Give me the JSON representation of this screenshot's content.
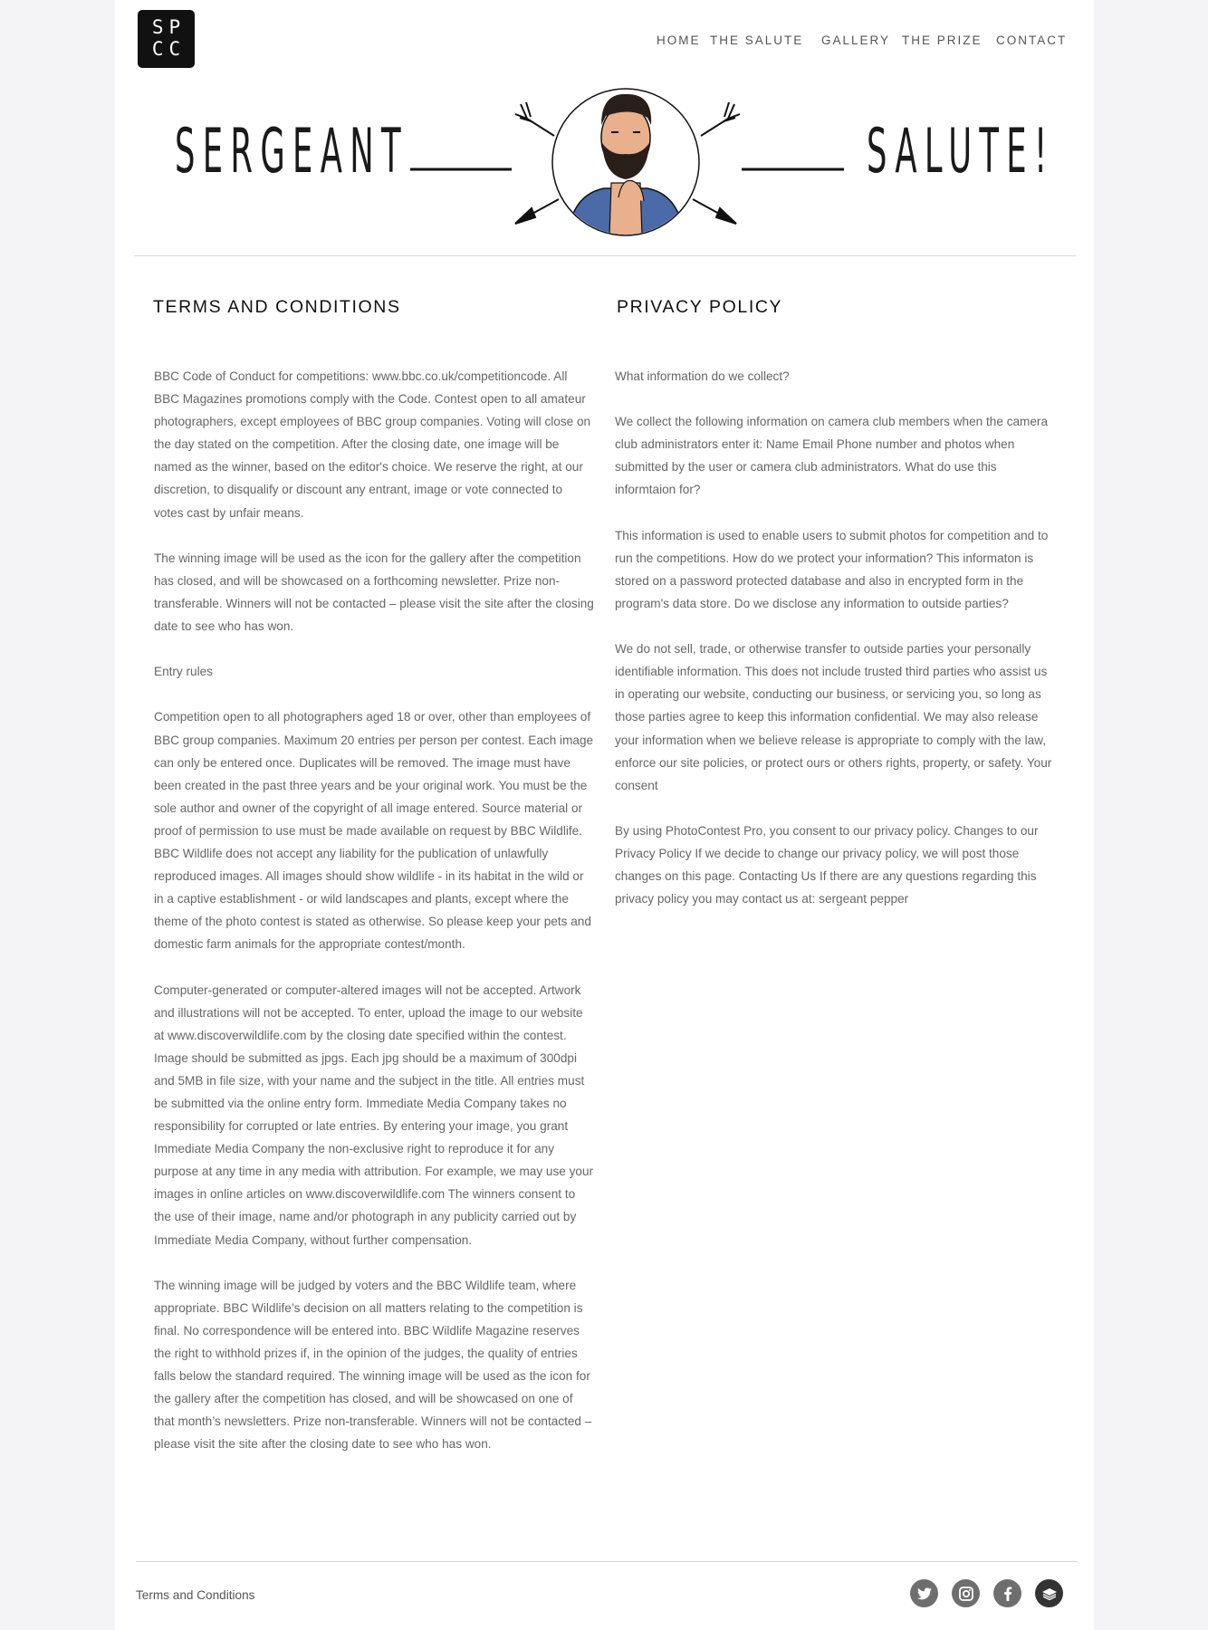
{
  "logo": {
    "line1": "SP",
    "line2": "CC"
  },
  "nav": {
    "items": [
      "HOME",
      "THE SALUTE",
      "GALLERY",
      "THE PRIZE",
      "CONTACT"
    ]
  },
  "banner": {
    "left_word": "SERGEANT",
    "right_word": "SALUTE!"
  },
  "terms": {
    "title": "TERMS AND CONDITIONS",
    "paragraphs": [
      "BBC Code of Conduct for competitions: www.bbc.co.uk/competitioncode. All BBC Magazines promotions comply with the Code. Contest open to all amateur photographers, except employees of BBC group companies. Voting will close on the day stated on the competition. After the closing date, one image will be named as the winner, based on the editor's choice. We reserve the right, at our discretion, to disqualify or discount any entrant, image or vote connected to votes cast by unfair means.",
      "The winning image will be used as the icon for the gallery after the competition has closed, and will be showcased on a forthcoming newsletter. Prize non-transferable. Winners will not be contacted – please visit the site after the closing date to see who has won.",
      "Entry rules",
      "Competition open to all photographers aged 18 or over, other than employees of BBC group companies. Maximum 20 entries per person per contest. Each image can only be entered once. Duplicates will be removed. The image must have been created in the past three years and be your original work. You must be the sole author and owner of the copyright of all image entered. Source material or proof of permission to use must be made available on request by BBC Wildlife. BBC Wildlife does not accept any liability for the publication of unlawfully reproduced images. All images should show wildlife - in its habitat in the wild or in a captive establishment - or wild landscapes and plants, except where the theme of the photo contest is stated as otherwise. So please keep your pets and domestic farm animals for the appropriate contest/month.",
      "Computer-generated or computer-altered images will not be accepted. Artwork and illustrations will not be accepted. To enter, upload the image to our website at www.discoverwildlife.com by the closing date specified within the contest. Image should be submitted as jpgs. Each jpg should be a maximum of 300dpi and 5MB in file size, with your name and the subject in the title. All entries must be submitted via the online entry form. Immediate Media Company takes no responsibility for corrupted or late entries. By entering your image, you grant Immediate Media Company the non-exclusive right to reproduce it for any purpose at any time in any media with attribution. For example, we may use your images in online articles on www.discoverwildlife.com The winners consent to the use of their image, name and/or photograph in any publicity carried out by Immediate Media Company, without further compensation.",
      "The winning image will be judged by voters and the BBC Wildlife team, where appropriate. BBC Wildlife’s decision on all matters relating to the competition is final. No correspondence will be entered into. BBC Wildlife Magazine reserves the right to withhold prizes if, in the opinion of the judges, the quality of entries falls below the standard required. The winning image will be used as the icon for the gallery after the competition has closed, and will be showcased on one of that month’s newsletters. Prize non-transferable. Winners will not be contacted – please visit the site after the closing date to see who has won."
    ]
  },
  "privacy": {
    "title": "PRIVACY POLICY",
    "paragraphs": [
      "What information do we collect?",
      "We collect the following information on camera club members when the camera club administrators enter it: Name Email Phone number and photos when submitted by the user or camera club administrators. What do use this informtaion for?",
      "This information is used to enable users to submit photos for competition and to run the competitions. How do we protect your information? This informaton is stored on a password protected database and also in encrypted form in the program's data store. Do we disclose any information to outside parties?",
      "We do not sell, trade, or otherwise transfer to outside parties your personally identifiable information. This does not include trusted third parties who assist us in operating our website, conducting our business, or servicing you, so long as those parties agree to keep this information confidential. We may also release your information when we believe release is appropriate to comply with the law, enforce our site policies, or protect ours or others rights, property, or safety. Your consent",
      "By using PhotoContest Pro, you consent to our privacy policy. Changes to our Privacy Policy If we decide to change our privacy policy, we will post those changes on this page. Contacting Us If there are any questions regarding this privacy policy you may contact us at: sergeant pepper"
    ]
  },
  "footer": {
    "link_label": "Terms and Conditions",
    "social": [
      "twitter-icon",
      "instagram-icon",
      "facebook-icon",
      "layers-icon"
    ]
  },
  "colors": {
    "page_bg": "#f4f4f6",
    "content_bg": "#ffffff",
    "text": "#666666",
    "heading": "#111111",
    "shirt": "#4a6aa8",
    "skin": "#e8b08c"
  }
}
